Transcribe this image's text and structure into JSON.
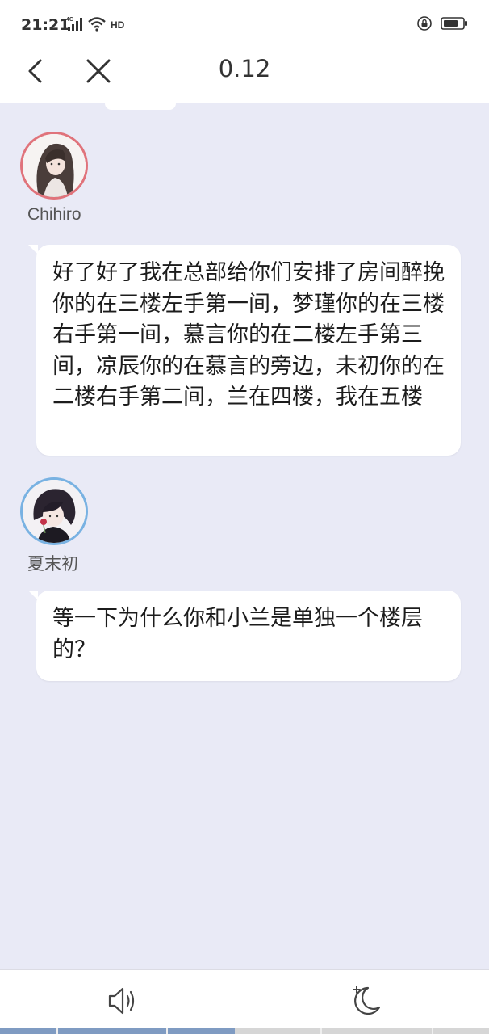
{
  "status_bar": {
    "time": "21:21",
    "network": "4G",
    "hd": "HD",
    "icons": [
      "signal-icon",
      "wifi-icon",
      "hd-icon",
      "lock-rotation-icon",
      "battery-icon"
    ]
  },
  "nav": {
    "title": "0.12",
    "icons": [
      "back-icon",
      "close-icon"
    ]
  },
  "messages": [
    {
      "sender": "Chihiro",
      "avatar_border": "#e0737b",
      "text": "好了好了我在总部给你们安排了房间醉挽你的在三楼左手第一间，梦瑾你的在三楼右手第一间，慕言你的在二楼左手第三间，凉辰你的在慕言的旁边，未初你的在二楼右手第二间，兰在四楼，我在五楼"
    },
    {
      "sender": "夏末初",
      "avatar_border": "#79b2e2",
      "text": "等一下为什么你和小兰是单独一个楼层的？"
    }
  ],
  "bottom_bar": {
    "icons": [
      "speaker-icon",
      "night-mode-icon"
    ]
  },
  "progress": {
    "fraction": 0.48,
    "color": "#7f9bc2"
  },
  "colors": {
    "background": "#e9eaf6",
    "bubble": "#ffffff"
  }
}
